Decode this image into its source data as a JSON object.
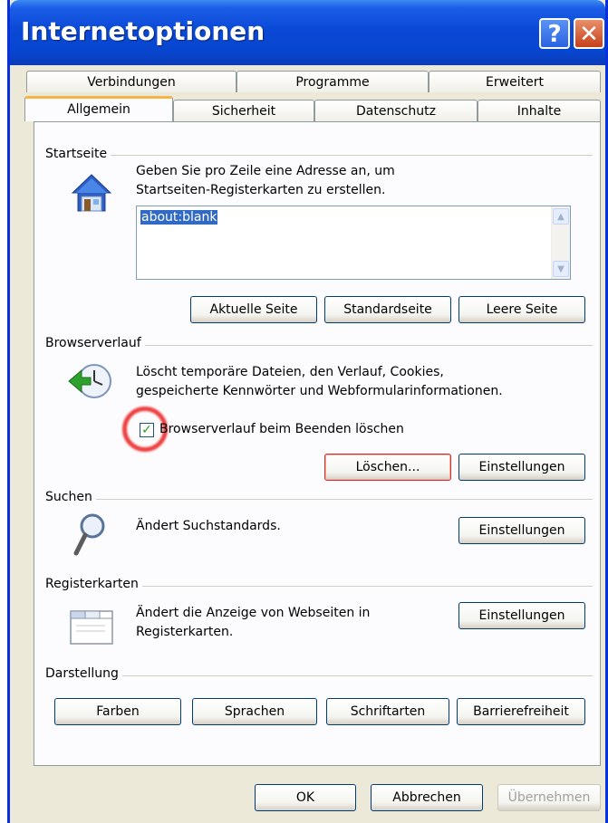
{
  "window": {
    "title": "Internetoptionen"
  },
  "titlebar_buttons": {
    "help": "?",
    "close": "✕"
  },
  "tabs_row1": [
    "Verbindungen",
    "Programme",
    "Erweitert"
  ],
  "tabs_row2": [
    "Allgemein",
    "Sicherheit",
    "Datenschutz",
    "Inhalte"
  ],
  "active_tab": "Allgemein",
  "startseite": {
    "label": "Startseite",
    "description_line1": "Geben Sie pro Zeile eine Adresse an, um",
    "description_line2": "Startseiten-Registerkarten zu erstellen.",
    "textarea_value": "about:blank",
    "btn_current": "Aktuelle Seite",
    "btn_default": "Standardseite",
    "btn_empty": "Leere Seite"
  },
  "browserverlauf": {
    "label": "Browserverlauf",
    "description_line1": "Löscht temporäre Dateien, den Verlauf, Cookies,",
    "description_line2": "gespeicherte Kennwörter und Webformularinformationen.",
    "checkbox_label": "Browserverlauf beim Beenden löschen",
    "checkbox_checked": true,
    "btn_delete": "Löschen...",
    "btn_settings": "Einstellungen"
  },
  "suchen": {
    "label": "Suchen",
    "description": "Ändert Suchstandards.",
    "btn_settings": "Einstellungen"
  },
  "registerkarten": {
    "label": "Registerkarten",
    "description_line1": "Ändert die Anzeige von Webseiten in",
    "description_line2": "Registerkarten.",
    "btn_settings": "Einstellungen"
  },
  "darstellung": {
    "label": "Darstellung",
    "btn_colors": "Farben",
    "btn_languages": "Sprachen",
    "btn_fonts": "Schriftarten",
    "btn_accessibility": "Barrierefreiheit"
  },
  "footer": {
    "ok": "OK",
    "cancel": "Abbrechen",
    "apply": "Übernehmen"
  },
  "colors": {
    "titlebar": "#0a49d6",
    "panel_bg": "#fcfcfe",
    "dialog_bg": "#ece9d8",
    "highlight_circle": "#eb1e1e",
    "active_tab_accent": "#f7b446"
  },
  "icons": {
    "startseite": "house-icon",
    "browserverlauf": "history-clock-icon",
    "suchen": "magnifier-icon",
    "registerkarten": "tabs-window-icon"
  }
}
